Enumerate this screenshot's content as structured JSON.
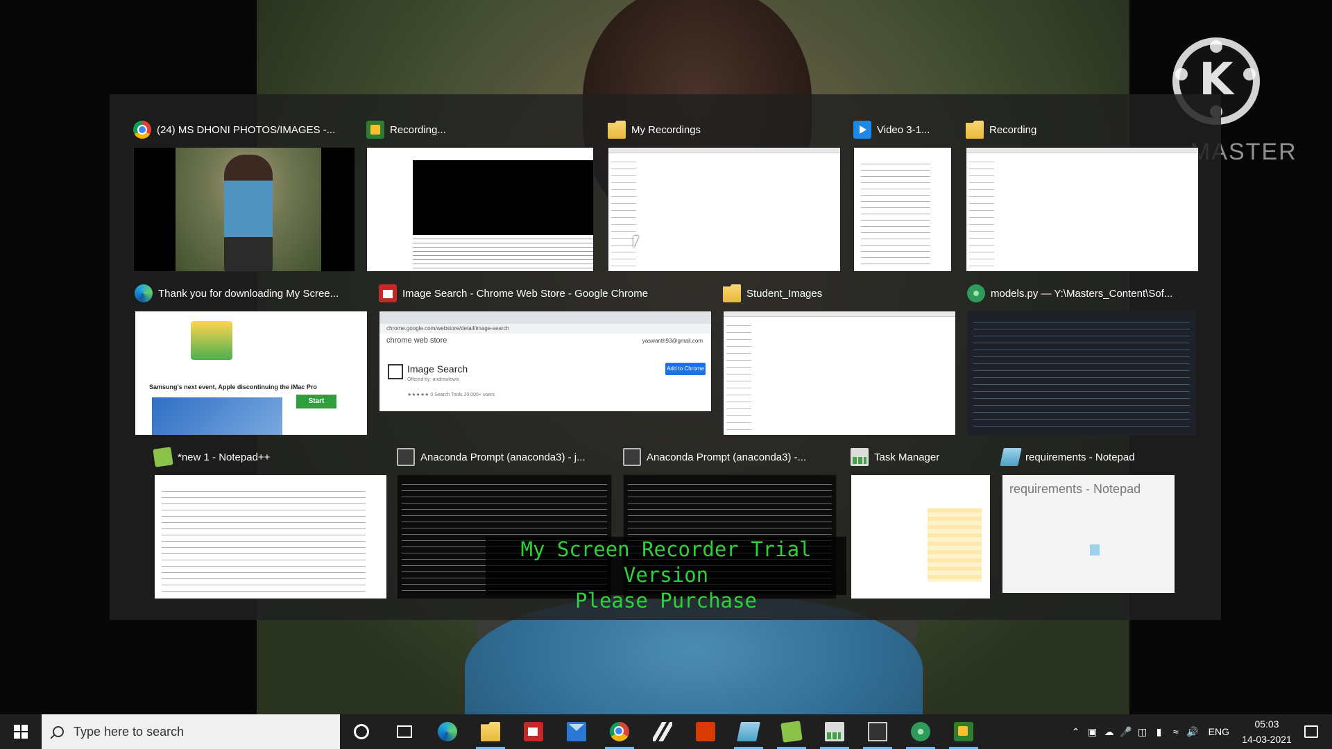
{
  "wallpaper": {
    "brand_text": "MASTER",
    "brand_logo_letter": "K"
  },
  "switcher": {
    "rows": [
      [
        {
          "title": "(24) MS DHONI PHOTOS/IMAGES -...",
          "icon": "chrome-icon"
        },
        {
          "title": "Recording...",
          "icon": "screen-recorder-icon"
        },
        {
          "title": "My Recordings",
          "icon": "folder-icon"
        },
        {
          "title": "Video 3-1...",
          "icon": "video-file-icon"
        },
        {
          "title": "Recording",
          "icon": "folder-icon"
        }
      ],
      [
        {
          "title": "Thank you for downloading My Scree...",
          "icon": "edge-icon"
        },
        {
          "title": "Image Search - Chrome Web Store - Google Chrome",
          "icon": "chrome-web-store-icon"
        },
        {
          "title": "Student_Images",
          "icon": "folder-icon"
        },
        {
          "title": "models.py — Y:\\Masters_Content\\Sof...",
          "icon": "atom-icon"
        }
      ],
      [
        {
          "title": "*new 1 - Notepad++",
          "icon": "notepad-plus-plus-icon"
        },
        {
          "title": "Anaconda Prompt (anaconda3) - j...",
          "icon": "console-icon"
        },
        {
          "title": "Anaconda Prompt (anaconda3) -...",
          "icon": "console-icon"
        },
        {
          "title": "Task Manager",
          "icon": "task-manager-icon"
        },
        {
          "title": "requirements - Notepad",
          "icon": "notepad-icon"
        }
      ]
    ],
    "store_preview": {
      "header": "chrome web store",
      "account": "yaswanth93@gmail.com",
      "item_title": "Image Search",
      "offered_by": "Offered by: andrewlewis",
      "meta": "★★★★★ 0   Search Tools   20,000+ users",
      "add_button": "Add to Chrome",
      "url": "chrome.google.com/webstore/detail/image-search"
    },
    "download_preview": {
      "banner": "Samsung's next event, Apple discontinuing the iMac Pro",
      "start": "Start"
    },
    "notepad_preview": {
      "label": "requirements - Notepad"
    }
  },
  "watermark": {
    "line1": "My Screen Recorder Trial Version",
    "line2": "Please Purchase"
  },
  "taskbar": {
    "search_placeholder": "Type here to search",
    "pinned": [
      "cortana-icon",
      "task-view-icon",
      "edge-icon",
      "file-explorer-icon",
      "microsoft-store-icon",
      "mail-icon",
      "chrome-icon",
      "app-slash-icon",
      "office-icon",
      "notepad-icon",
      "notepad-plus-plus-icon",
      "task-manager-icon",
      "console-icon",
      "atom-icon",
      "screen-recorder-icon"
    ],
    "tray": {
      "language": "ENG",
      "time": "05:03",
      "date": "14-03-2021"
    }
  }
}
